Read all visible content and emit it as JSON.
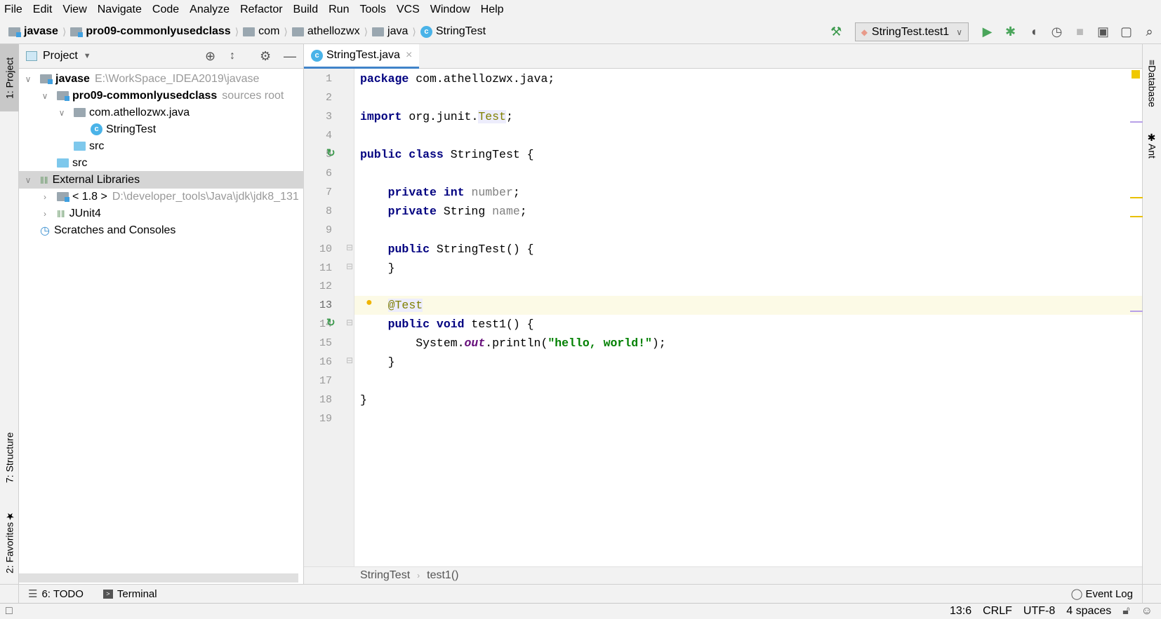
{
  "menu": [
    "File",
    "Edit",
    "View",
    "Navigate",
    "Code",
    "Analyze",
    "Refactor",
    "Build",
    "Run",
    "Tools",
    "VCS",
    "Window",
    "Help"
  ],
  "nav": {
    "crumbs": [
      {
        "label": "javase",
        "bold": true,
        "icon": "module-folder"
      },
      {
        "label": "pro09-commonlyusedclass",
        "bold": true,
        "icon": "module-folder"
      },
      {
        "label": "com",
        "icon": "package-folder"
      },
      {
        "label": "athellozwx",
        "icon": "package-folder"
      },
      {
        "label": "java",
        "icon": "package-folder"
      },
      {
        "label": "StringTest",
        "icon": "class-icon"
      }
    ],
    "run_config": "StringTest.test1"
  },
  "left_stripe": {
    "project": "1: Project",
    "structure": "7: Structure",
    "favorites": "2: Favorites"
  },
  "right_stripe": {
    "database": "Database",
    "ant": "Ant"
  },
  "project": {
    "title": "Project",
    "tree": [
      {
        "name": "javase",
        "hint": "E:\\WorkSpace_IDEA2019\\javase",
        "depth": 0,
        "arrow": "down",
        "icon": "module",
        "bold": true
      },
      {
        "name": "pro09-commonlyusedclass",
        "hint": "sources root",
        "depth": 1,
        "arrow": "down",
        "icon": "module",
        "bold": true
      },
      {
        "name": "com.athellozwx.java",
        "hint": "",
        "depth": 2,
        "arrow": "down",
        "icon": "package"
      },
      {
        "name": "StringTest",
        "hint": "",
        "depth": 3,
        "arrow": "",
        "icon": "class"
      },
      {
        "name": "src",
        "hint": "",
        "depth": 2,
        "arrow": "",
        "icon": "folder"
      },
      {
        "name": "src",
        "hint": "",
        "depth": 1,
        "arrow": "",
        "icon": "folder"
      },
      {
        "name": "External Libraries",
        "hint": "",
        "depth": 0,
        "arrow": "down",
        "icon": "library",
        "selected": true
      },
      {
        "name": "< 1.8 >",
        "hint": "D:\\developer_tools\\Java\\jdk\\jdk8_131",
        "depth": 1,
        "arrow": "right",
        "icon": "jdk"
      },
      {
        "name": "JUnit4",
        "hint": "",
        "depth": 1,
        "arrow": "right",
        "icon": "library"
      },
      {
        "name": "Scratches and Consoles",
        "hint": "",
        "depth": 0,
        "arrow": "",
        "icon": "scratches"
      }
    ]
  },
  "editor": {
    "tab": "StringTest.java",
    "current_line": 13,
    "lines": [
      [
        [
          "package",
          "kw"
        ],
        [
          " com.athellozwx.java;",
          ""
        ]
      ],
      [],
      [
        [
          "import",
          "kw"
        ],
        [
          " org.junit.",
          ""
        ],
        [
          "Test",
          "ann"
        ],
        [
          ";",
          ""
        ]
      ],
      [],
      [
        [
          "public class",
          "kw"
        ],
        [
          " StringTest {",
          ""
        ]
      ],
      [],
      [
        [
          "    ",
          ""
        ],
        [
          "private int",
          "kw"
        ],
        [
          " ",
          ""
        ],
        [
          "number",
          "unused"
        ],
        [
          ";",
          ""
        ]
      ],
      [
        [
          "    ",
          ""
        ],
        [
          "private",
          "kw"
        ],
        [
          " String ",
          ""
        ],
        [
          "name",
          "unused"
        ],
        [
          ";",
          ""
        ]
      ],
      [],
      [
        [
          "    ",
          ""
        ],
        [
          "public",
          "kw"
        ],
        [
          " StringTest() {",
          ""
        ]
      ],
      [
        [
          "    }",
          ""
        ]
      ],
      [],
      [
        [
          "    ",
          ""
        ],
        [
          "@Test",
          "ann"
        ]
      ],
      [
        [
          "    ",
          ""
        ],
        [
          "public void",
          "kw"
        ],
        [
          " test1() {",
          ""
        ]
      ],
      [
        [
          "        System.",
          ""
        ],
        [
          "out",
          "st"
        ],
        [
          ".println(",
          ""
        ],
        [
          "\"hello, world!\"",
          "str"
        ],
        [
          ");",
          ""
        ]
      ],
      [
        [
          "    }",
          ""
        ]
      ],
      [],
      [
        [
          "}",
          ""
        ]
      ],
      []
    ],
    "breadcrumb": [
      "StringTest",
      "test1()"
    ]
  },
  "bottom_tabs": {
    "todo": "6: TODO",
    "terminal": "Terminal",
    "event_log": "Event Log"
  },
  "status": {
    "position": "13:6",
    "line_sep": "CRLF",
    "encoding": "UTF-8",
    "indent": "4 spaces"
  }
}
